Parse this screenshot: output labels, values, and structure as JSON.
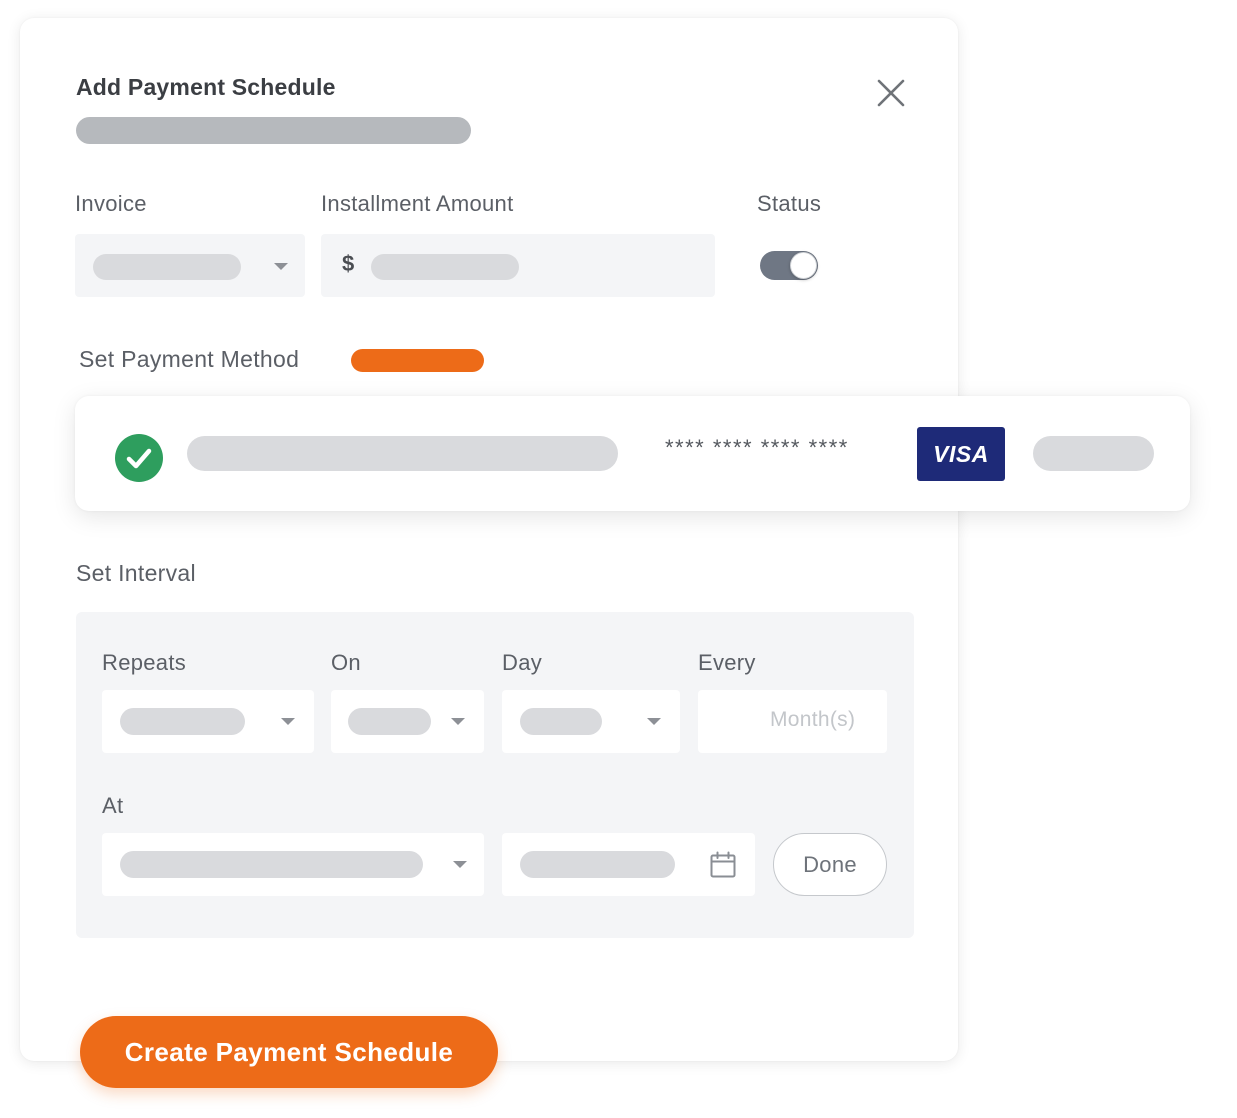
{
  "modal": {
    "title": "Add Payment Schedule",
    "close_icon": "close-icon"
  },
  "fields": {
    "invoice_label": "Invoice",
    "installment_label": "Installment Amount",
    "currency_symbol": "$",
    "status_label": "Status",
    "status_on": true
  },
  "payment_method": {
    "section_label": "Set Payment Method",
    "card_mask": "**** **** **** ****",
    "card_brand": "VISA",
    "selected_icon": "check-circle-icon"
  },
  "interval": {
    "section_label": "Set Interval",
    "repeats_label": "Repeats",
    "on_label": "On",
    "day_label": "Day",
    "every_label": "Every",
    "every_placeholder": "Month(s)",
    "at_label": "At",
    "calendar_icon": "calendar-icon",
    "done_label": "Done"
  },
  "actions": {
    "create_label": "Create Payment Schedule"
  },
  "colors": {
    "accent_orange": "#ed6b18",
    "success_green": "#2e9e5e",
    "visa_blue": "#1e2a78",
    "toggle_on": "#6f7784"
  }
}
